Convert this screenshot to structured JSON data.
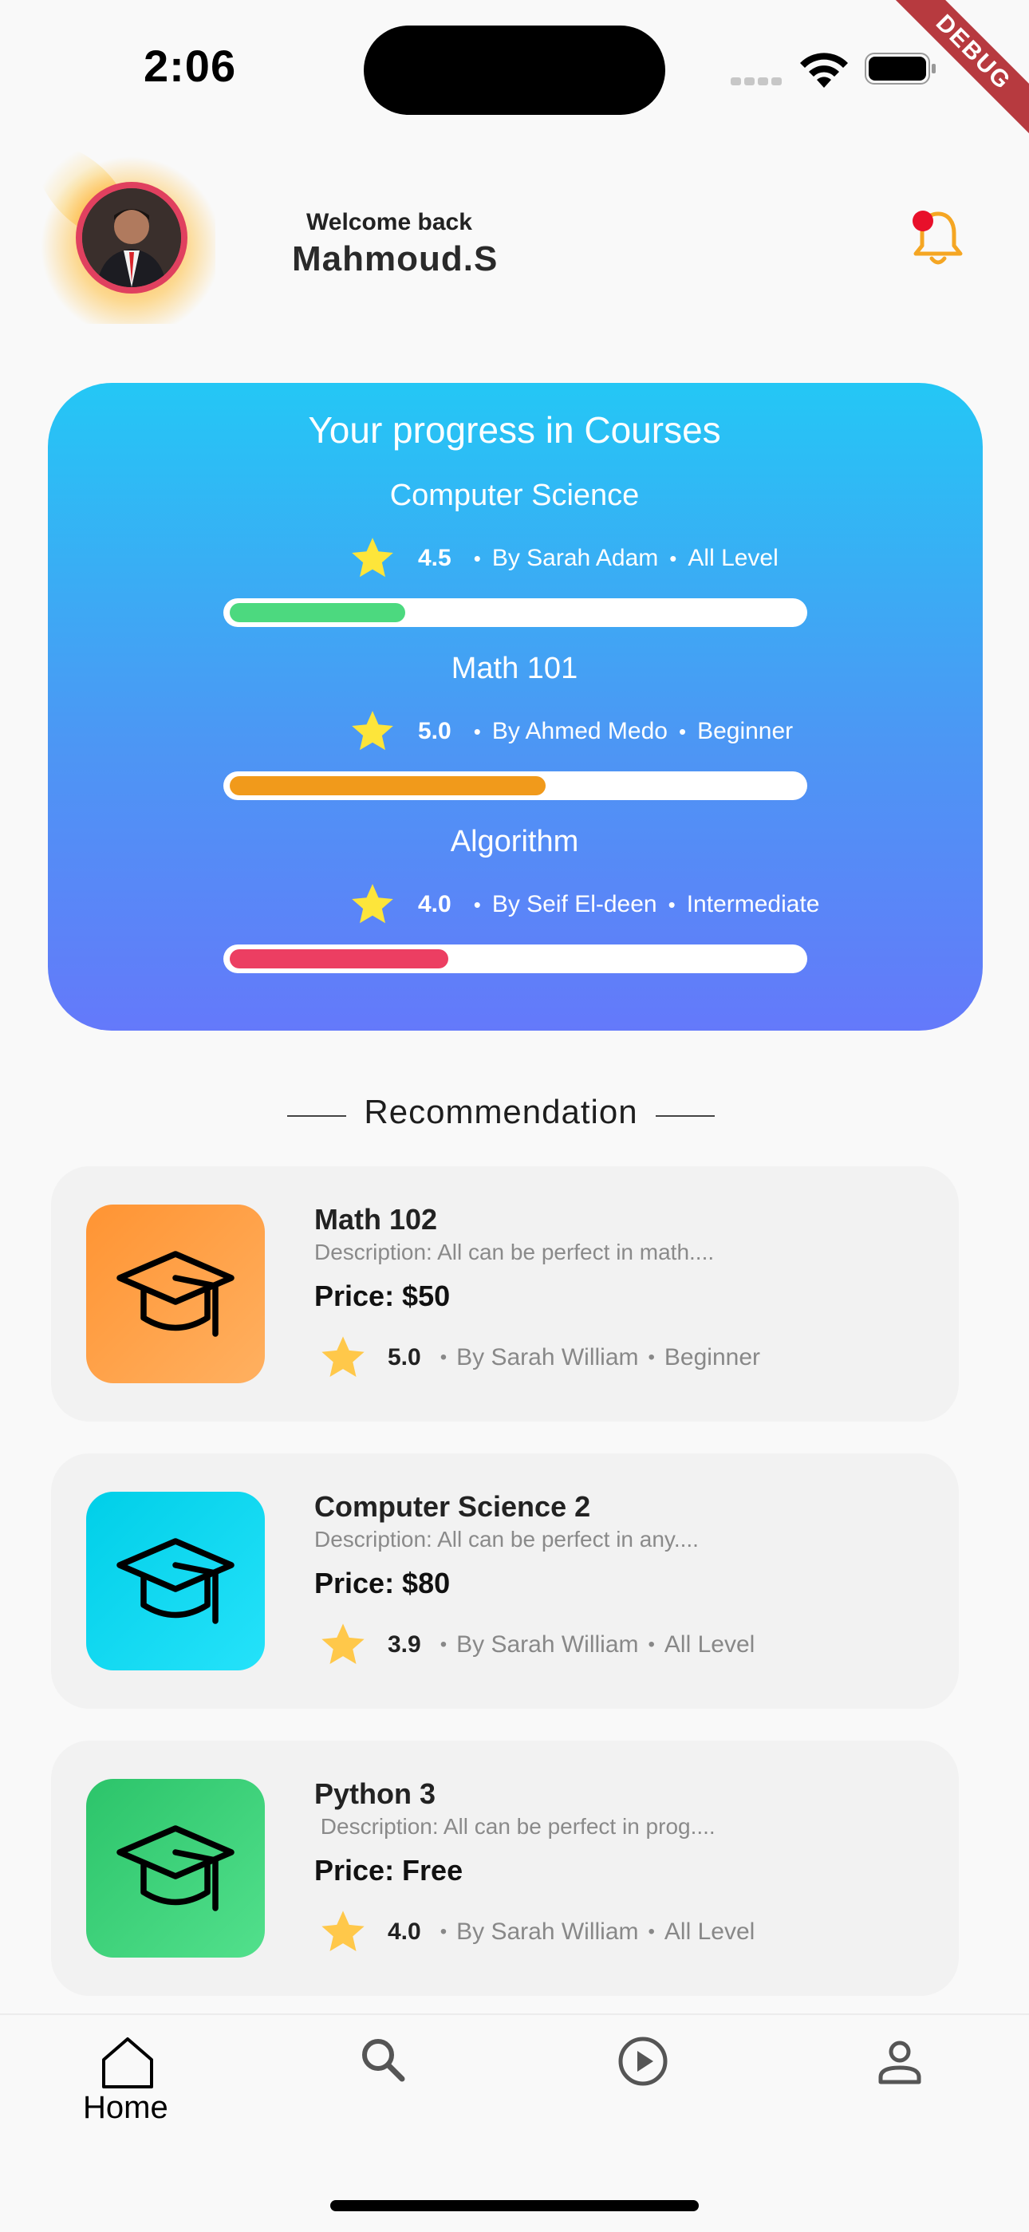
{
  "status_bar": {
    "time": "2:06",
    "debug_banner": "DEBUG"
  },
  "header": {
    "welcome_text": "Welcome back",
    "username": "Mahmoud.S",
    "notification_dot_color": "#e8102a"
  },
  "progress_card": {
    "title": "Your  progress in Courses",
    "gradient": [
      "#24c7f5",
      "#6479fa"
    ],
    "courses": [
      {
        "name": "Computer Science",
        "rating": "4.5",
        "author": "By Sarah Adam",
        "level": "All Level",
        "progress": 0.3,
        "bar_color": "#4cd97f"
      },
      {
        "name": "Math 101",
        "rating": "5.0",
        "author": "By Ahmed Medo",
        "level": "Beginner",
        "progress": 0.55,
        "bar_color": "#f19a1b"
      },
      {
        "name": "Algorithm",
        "rating": "4.0",
        "author": "By Seif El-deen",
        "level": "Intermediate",
        "progress": 0.38,
        "bar_color": "#ec3e62"
      }
    ]
  },
  "recommendation": {
    "heading": "Recommendation",
    "items": [
      {
        "name": "Math 102",
        "description": "Description: All can be perfect in math....",
        "price": "Price: $50",
        "rating": "5.0",
        "author": "By Sarah William",
        "level": "Beginner",
        "icon": "graduation-cap-icon",
        "icon_gradient": [
          "#ff9433",
          "#ffb060"
        ]
      },
      {
        "name": "Computer Science 2",
        "description": "Description: All can be perfect in any....",
        "price": "Price: $80",
        "rating": "3.9",
        "author": "By Sarah William",
        "level": "All Level",
        "icon": "graduation-cap-icon",
        "icon_gradient": [
          "#00cfe8",
          "#25e2fa"
        ]
      },
      {
        "name": "Python 3",
        "description": " Description: All can be perfect in prog....",
        "price": "Price: Free",
        "rating": "4.0",
        "author": "By Sarah William",
        "level": "All Level",
        "icon": "graduation-cap-icon",
        "icon_gradient": [
          "#2cc46a",
          "#52e08c"
        ]
      }
    ]
  },
  "bottom_nav": {
    "items": [
      {
        "label": "Home",
        "icon": "home-icon",
        "active": true
      },
      {
        "label": "",
        "icon": "search-icon",
        "active": false
      },
      {
        "label": "",
        "icon": "play-circle-icon",
        "active": false
      },
      {
        "label": "",
        "icon": "profile-icon",
        "active": false
      }
    ]
  },
  "colors": {
    "star": "#fde53a",
    "star_recommend": "#ffc84a",
    "background": "#f9f9f9"
  }
}
